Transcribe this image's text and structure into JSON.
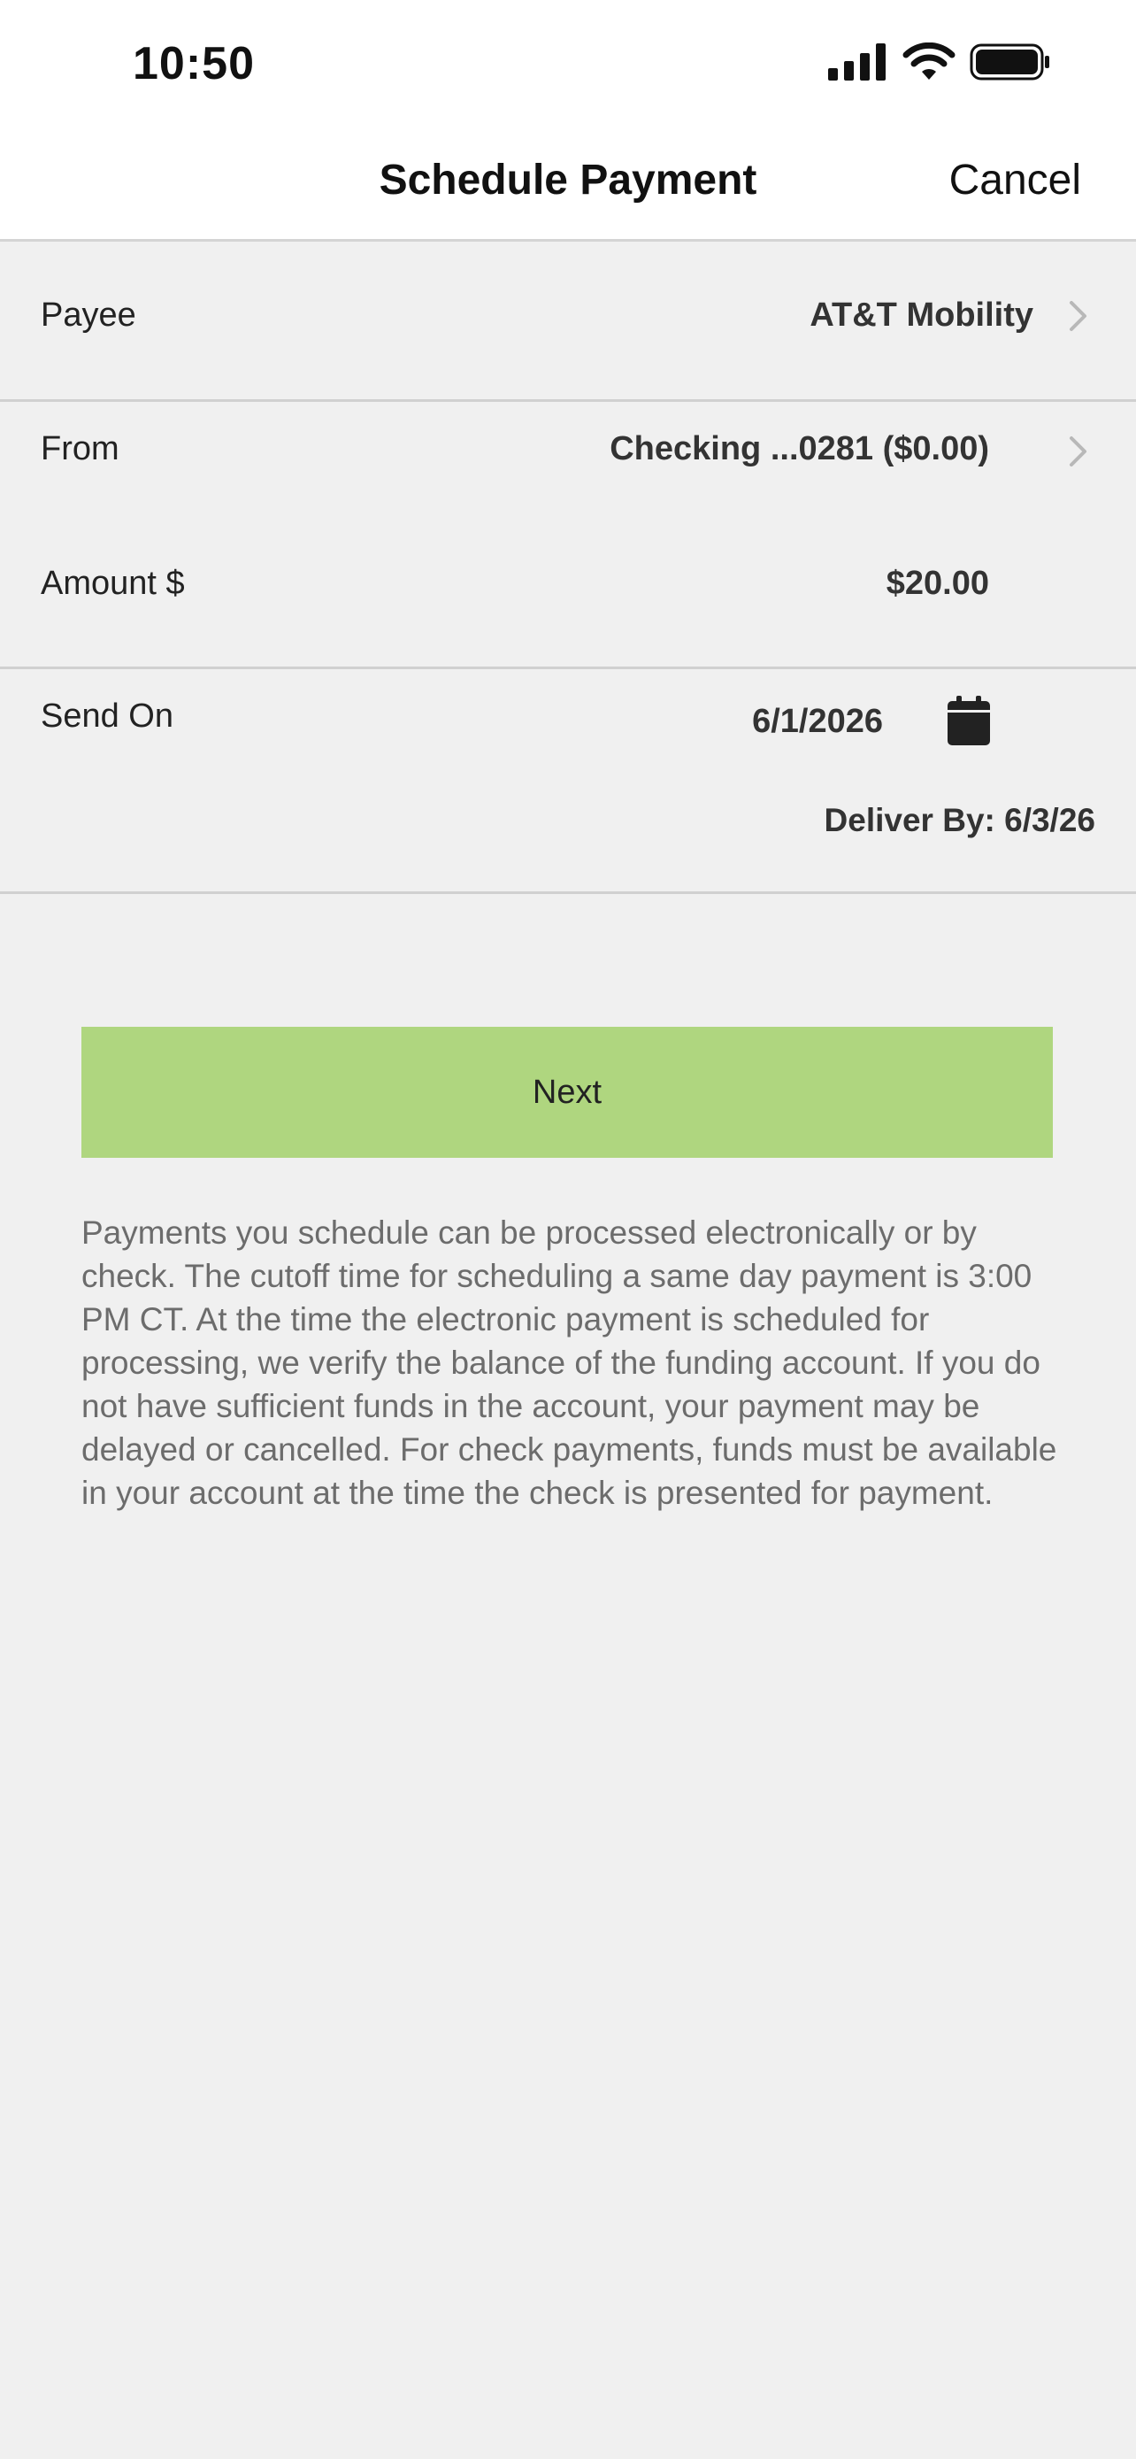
{
  "status_bar": {
    "time": "10:50"
  },
  "header": {
    "title": "Schedule Payment",
    "cancel_label": "Cancel"
  },
  "form": {
    "payee": {
      "label": "Payee",
      "value": "AT&T Mobility"
    },
    "from": {
      "label": "From",
      "value": "Checking ...0281 ($0.00)"
    },
    "amount": {
      "label": "Amount $",
      "value": "$20.00"
    },
    "send_on": {
      "label": "Send On",
      "value": "6/1/2026",
      "deliver_by": "Deliver By: 6/3/26"
    }
  },
  "next_button": {
    "label": "Next"
  },
  "disclaimer": "Payments you schedule can be processed electronically or by check. The cutoff time for scheduling a same day payment is 3:00 PM CT. At the time the electronic payment is scheduled for processing, we verify the balance of the funding account. If you do not have sufficient funds in the account, your payment may be delayed or cancelled. For check payments, funds must be available in your account at the time the check is presented for payment.",
  "colors": {
    "accent_button": "#afd67f",
    "background": "#f0f0f0",
    "divider": "#d0d0d0"
  },
  "icons": {
    "signal": "cellular-signal-icon",
    "wifi": "wifi-icon",
    "battery": "battery-icon",
    "chevron": "chevron-right-icon",
    "calendar": "calendar-icon"
  }
}
